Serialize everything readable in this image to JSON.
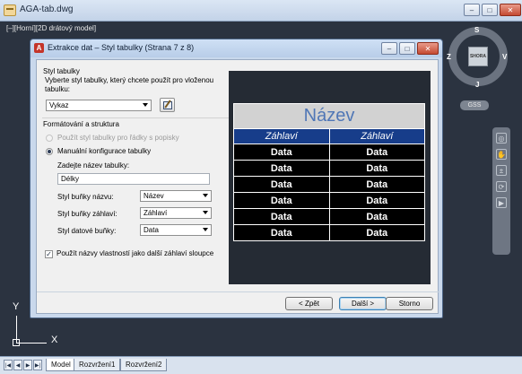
{
  "app": {
    "title": "AGA-tab.dwg",
    "window_buttons": [
      "–",
      "□",
      "✕"
    ]
  },
  "viewport": {
    "label": "[–][Horní][2D drátový model]",
    "ucs_x": "X",
    "ucs_y": "Y"
  },
  "viewcube": {
    "face": "SHORA",
    "north": "S",
    "south": "J",
    "east": "V",
    "west": "Z",
    "wcs": "GSS"
  },
  "navbar": {
    "tools": [
      "steering-wheel-icon",
      "pan-icon",
      "zoom-icon",
      "orbit-icon",
      "showmotion-icon"
    ]
  },
  "tabs": {
    "items": [
      "Model",
      "Rozvržení1",
      "Rozvržení2"
    ],
    "active": "Model",
    "nav_buttons": [
      "|◀",
      "◀",
      "▶",
      "▶|"
    ]
  },
  "dialog": {
    "title": "Extrakce dat – Styl tabulky (Strana 7 z 8)",
    "table_style": {
      "group_label": "Styl tabulky",
      "description": "Vyberte styl tabulky, který chcete použít pro vloženou tabulku:",
      "selected": "Vykaz"
    },
    "format": {
      "group_label": "Formátování a struktura",
      "radio_use_labels": "Použít styl tabulky pro řádky s popisky",
      "radio_manual": "Manuální konfigurace tabulky",
      "title_prompt": "Zadejte název tabulky:",
      "title_value": "Délky",
      "title_cell_style_label": "Styl buňky názvu:",
      "title_cell_style_value": "Název",
      "header_cell_style_label": "Styl buňky záhlaví:",
      "header_cell_style_value": "Záhlaví",
      "data_cell_style_label": "Styl datové buňky:",
      "data_cell_style_value": "Data",
      "checkbox_label": "Použít názvy vlastností jako další záhlaví sloupce",
      "checkbox_checked": true
    },
    "preview": {
      "title": "Název",
      "headers": [
        "Záhlaví",
        "Záhlaví"
      ],
      "rows": [
        [
          "Data",
          "Data"
        ],
        [
          "Data",
          "Data"
        ],
        [
          "Data",
          "Data"
        ],
        [
          "Data",
          "Data"
        ],
        [
          "Data",
          "Data"
        ],
        [
          "Data",
          "Data"
        ]
      ]
    },
    "buttons": {
      "back": "< Zpět",
      "next": "Další >",
      "cancel": "Storno"
    }
  }
}
